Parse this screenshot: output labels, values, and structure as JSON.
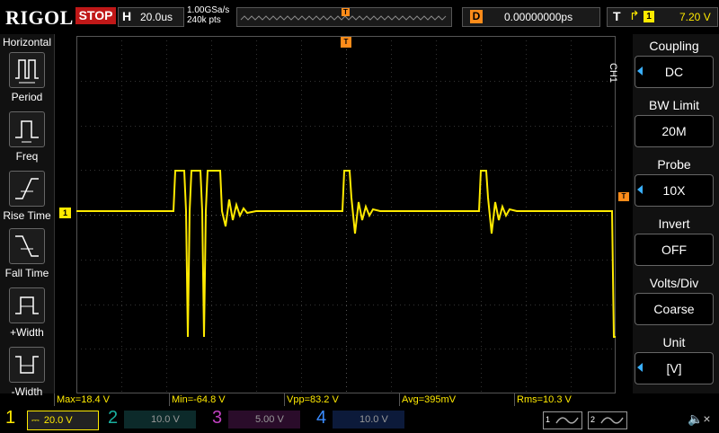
{
  "topbar": {
    "brand": "RIGOL",
    "run_status": "STOP",
    "timebase_label": "H",
    "timebase_value": "20.0us",
    "sample_rate": "1.00GSa/s",
    "memory_depth": "240k pts",
    "delay_label": "D",
    "delay_value": "0.00000000ps",
    "trigger_label": "T",
    "trigger_edge_icon": "rising-edge-icon",
    "trigger_source": "1",
    "trigger_level": "7.20 V"
  },
  "left_menu": {
    "title": "Horizontal",
    "items": [
      {
        "label": "Period",
        "icon": "period-icon"
      },
      {
        "label": "Freq",
        "icon": "frequency-icon"
      },
      {
        "label": "Rise Time",
        "icon": "rise-time-icon"
      },
      {
        "label": "Fall Time",
        "icon": "fall-time-icon"
      },
      {
        "label": "+Width",
        "icon": "positive-width-icon"
      },
      {
        "label": "-Width",
        "icon": "negative-width-icon"
      }
    ]
  },
  "right_menu": {
    "channel_label": "CH1",
    "items": [
      {
        "title": "Coupling",
        "value": "DC"
      },
      {
        "title": "BW Limit",
        "value": "20M"
      },
      {
        "title": "Probe",
        "value": "10X"
      },
      {
        "title": "Invert",
        "value": "OFF"
      },
      {
        "title": "Volts/Div",
        "value": "Coarse"
      },
      {
        "title": "Unit",
        "value": "[V]"
      }
    ]
  },
  "scope": {
    "ch1_marker": "1",
    "trigger_marker": "T",
    "colors": {
      "trace": "#ffea00",
      "grid": "#3a3a3a",
      "trigger": "#ff8c1a"
    }
  },
  "measurements": [
    {
      "label": "Max=18.4 V"
    },
    {
      "label": "Min=-64.8 V"
    },
    {
      "label": "Vpp=83.2 V"
    },
    {
      "label": "Avg=395mV"
    },
    {
      "label": "Rms=10.3 V"
    }
  ],
  "bottombar": {
    "ch1": {
      "num": "1",
      "scale": "20.0 V"
    },
    "ch2": {
      "num": "2",
      "scale": "10.0 V"
    },
    "ch3": {
      "num": "3",
      "scale": "5.00 V"
    },
    "ch4": {
      "num": "4",
      "scale": "10.0 V"
    },
    "gen1_label": "1",
    "gen2_label": "2",
    "speaker_icon": "speaker-muted-icon"
  }
}
